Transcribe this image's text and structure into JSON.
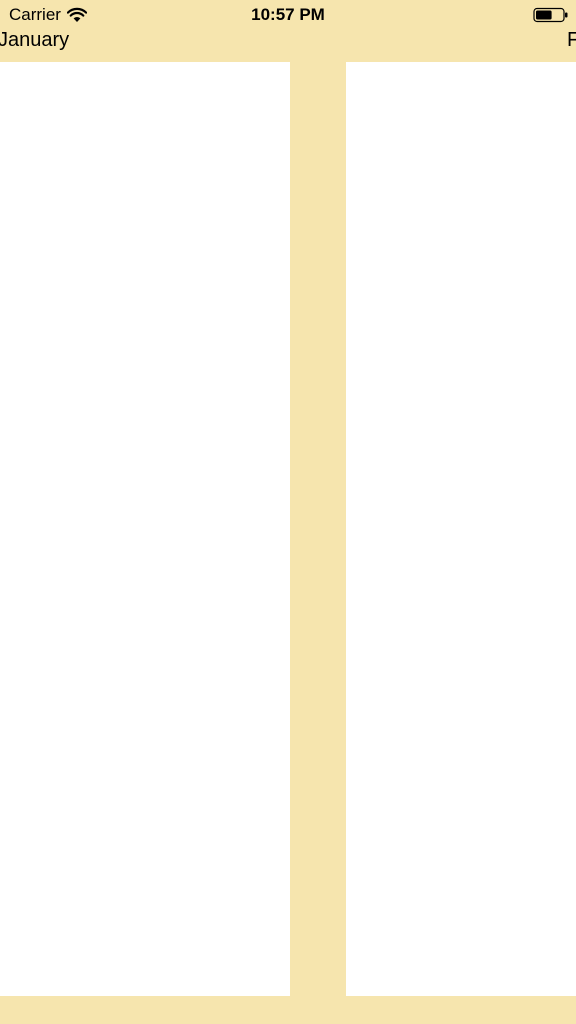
{
  "status_bar": {
    "carrier": "Carrier",
    "time": "10:57 PM",
    "wifi_icon": "wifi-icon",
    "battery_icon": "battery-icon",
    "battery_level": 0.6
  },
  "pages": {
    "current_month": "January",
    "next_month": "F"
  },
  "colors": {
    "background": "#f6e5ae",
    "panel": "#ffffff"
  }
}
